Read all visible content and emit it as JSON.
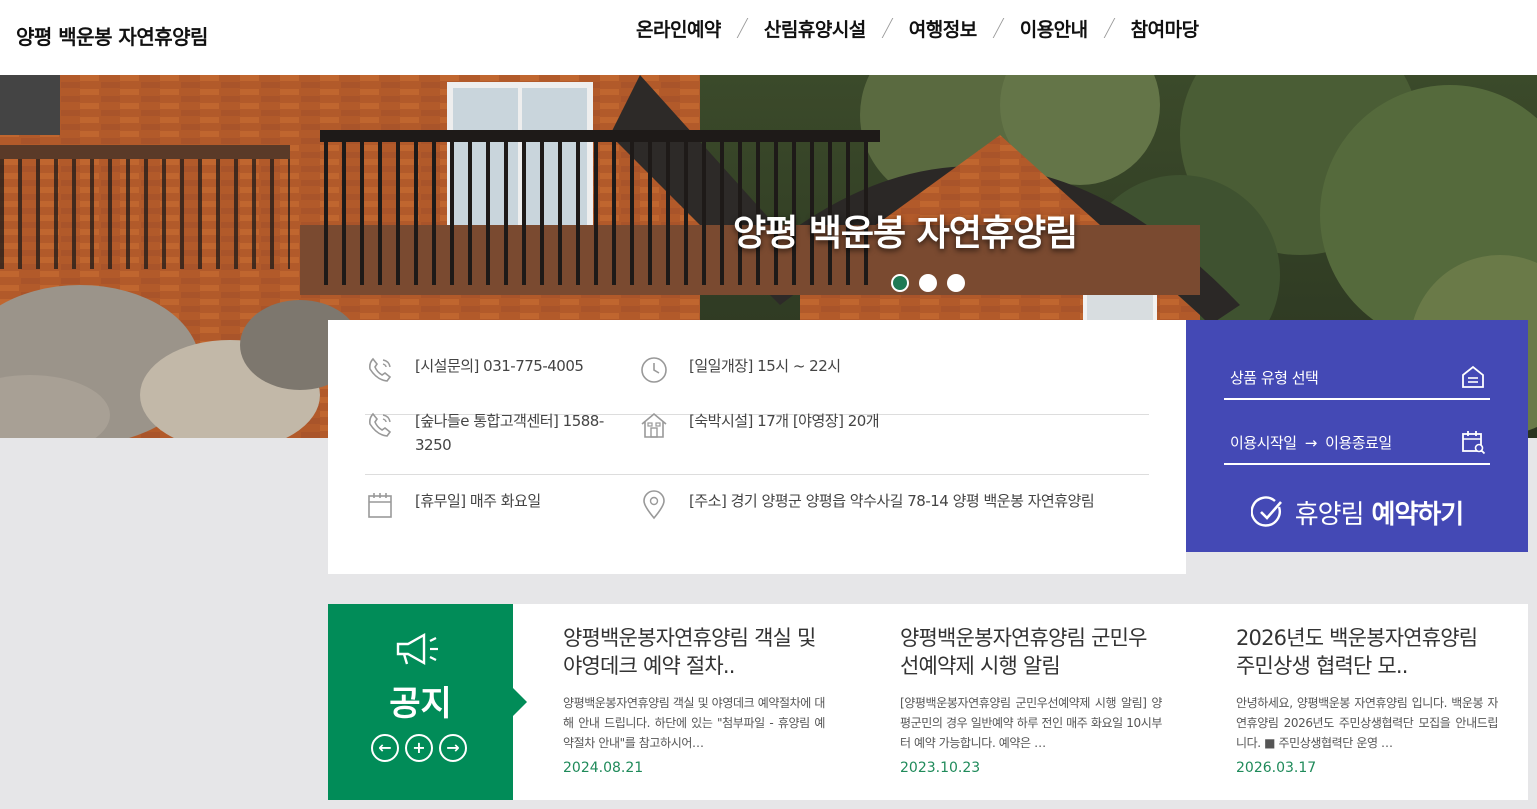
{
  "header": {
    "logo": "양평 백운봉 자연휴양림",
    "nav": [
      "온라인예약",
      "산림휴양시설",
      "여행정보",
      "이용안내",
      "참여마당"
    ]
  },
  "hero": {
    "title": "양평 백운봉 자연휴양림",
    "slide_count": 3,
    "active_slide": 1
  },
  "info": {
    "phone": "[시설문의] 031-775-4005",
    "hours": "[일일개장] 15시 ~ 22시",
    "callcenter": "[숲나들e 통합고객센터] 1588-3250",
    "lodging": "[숙박시설] 17개 [야영장] 20개",
    "closed": "[휴무일] 매주 화요일",
    "address": "[주소] 경기 양평군 양평읍 약수사길 78-14 양평 백운봉 자연휴양림"
  },
  "booking": {
    "product_type": "상품 유형 선택",
    "start_date": "이용시작일",
    "arrow": "→",
    "end_date": "이용종료일",
    "button_light": "휴양림",
    "button_bold": "예약하기"
  },
  "notice": {
    "title": "공지",
    "controls": {
      "prev": "←",
      "add": "+",
      "next": "→"
    },
    "items": [
      {
        "title": "양평백운봉자연휴양림 객실 및 야영데크 예약 절차..",
        "body": "양평백운봉자연휴양림 객실 및 야영데크 예약절차에 대해 안내 드립니다. 하단에 있는 \"첨부파일 - 휴양림 예약절차 안내\"를 참고하시어…",
        "date": "2024.08.21"
      },
      {
        "title": "양평백운봉자연휴양림 군민우선예약제 시행 알림",
        "body": "[양평백운봉자연휴양림 군민우선예약제 시행 알림] 양평군민의 경우 일반예약 하루 전인 매주 화요일 10시부터 예약 가능합니다. 예약은 …",
        "date": "2023.10.23"
      },
      {
        "title": "2026년도 백운봉자연휴양림 주민상생 협력단 모..",
        "body": "안녕하세요, 양평백운봉 자연휴양림 입니다. 백운봉 자연휴양림 2026년도 주민상생협력단 모집을 안내드립니다. ■ 주민상생협력단 운영 …",
        "date": "2026.03.17"
      }
    ]
  },
  "colors": {
    "brand_green": "#018c58",
    "booking_blue": "#4449b5",
    "active_dot": "#1f7a55"
  }
}
